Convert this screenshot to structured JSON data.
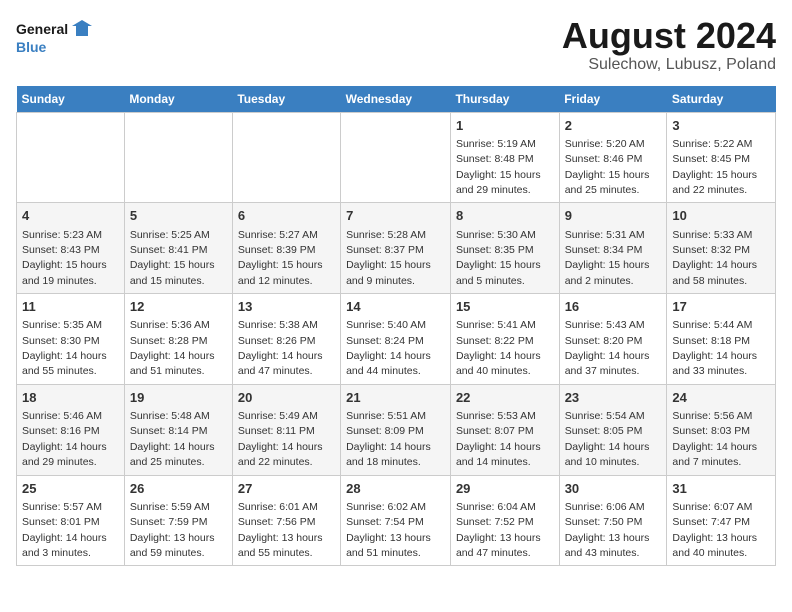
{
  "logo": {
    "line1": "General",
    "line2": "Blue"
  },
  "title": "August 2024",
  "subtitle": "Sulechow, Lubusz, Poland",
  "days_of_week": [
    "Sunday",
    "Monday",
    "Tuesday",
    "Wednesday",
    "Thursday",
    "Friday",
    "Saturday"
  ],
  "weeks": [
    [
      {
        "day": "",
        "info": ""
      },
      {
        "day": "",
        "info": ""
      },
      {
        "day": "",
        "info": ""
      },
      {
        "day": "",
        "info": ""
      },
      {
        "day": "1",
        "info": "Sunrise: 5:19 AM\nSunset: 8:48 PM\nDaylight: 15 hours\nand 29 minutes."
      },
      {
        "day": "2",
        "info": "Sunrise: 5:20 AM\nSunset: 8:46 PM\nDaylight: 15 hours\nand 25 minutes."
      },
      {
        "day": "3",
        "info": "Sunrise: 5:22 AM\nSunset: 8:45 PM\nDaylight: 15 hours\nand 22 minutes."
      }
    ],
    [
      {
        "day": "4",
        "info": "Sunrise: 5:23 AM\nSunset: 8:43 PM\nDaylight: 15 hours\nand 19 minutes."
      },
      {
        "day": "5",
        "info": "Sunrise: 5:25 AM\nSunset: 8:41 PM\nDaylight: 15 hours\nand 15 minutes."
      },
      {
        "day": "6",
        "info": "Sunrise: 5:27 AM\nSunset: 8:39 PM\nDaylight: 15 hours\nand 12 minutes."
      },
      {
        "day": "7",
        "info": "Sunrise: 5:28 AM\nSunset: 8:37 PM\nDaylight: 15 hours\nand 9 minutes."
      },
      {
        "day": "8",
        "info": "Sunrise: 5:30 AM\nSunset: 8:35 PM\nDaylight: 15 hours\nand 5 minutes."
      },
      {
        "day": "9",
        "info": "Sunrise: 5:31 AM\nSunset: 8:34 PM\nDaylight: 15 hours\nand 2 minutes."
      },
      {
        "day": "10",
        "info": "Sunrise: 5:33 AM\nSunset: 8:32 PM\nDaylight: 14 hours\nand 58 minutes."
      }
    ],
    [
      {
        "day": "11",
        "info": "Sunrise: 5:35 AM\nSunset: 8:30 PM\nDaylight: 14 hours\nand 55 minutes."
      },
      {
        "day": "12",
        "info": "Sunrise: 5:36 AM\nSunset: 8:28 PM\nDaylight: 14 hours\nand 51 minutes."
      },
      {
        "day": "13",
        "info": "Sunrise: 5:38 AM\nSunset: 8:26 PM\nDaylight: 14 hours\nand 47 minutes."
      },
      {
        "day": "14",
        "info": "Sunrise: 5:40 AM\nSunset: 8:24 PM\nDaylight: 14 hours\nand 44 minutes."
      },
      {
        "day": "15",
        "info": "Sunrise: 5:41 AM\nSunset: 8:22 PM\nDaylight: 14 hours\nand 40 minutes."
      },
      {
        "day": "16",
        "info": "Sunrise: 5:43 AM\nSunset: 8:20 PM\nDaylight: 14 hours\nand 37 minutes."
      },
      {
        "day": "17",
        "info": "Sunrise: 5:44 AM\nSunset: 8:18 PM\nDaylight: 14 hours\nand 33 minutes."
      }
    ],
    [
      {
        "day": "18",
        "info": "Sunrise: 5:46 AM\nSunset: 8:16 PM\nDaylight: 14 hours\nand 29 minutes."
      },
      {
        "day": "19",
        "info": "Sunrise: 5:48 AM\nSunset: 8:14 PM\nDaylight: 14 hours\nand 25 minutes."
      },
      {
        "day": "20",
        "info": "Sunrise: 5:49 AM\nSunset: 8:11 PM\nDaylight: 14 hours\nand 22 minutes."
      },
      {
        "day": "21",
        "info": "Sunrise: 5:51 AM\nSunset: 8:09 PM\nDaylight: 14 hours\nand 18 minutes."
      },
      {
        "day": "22",
        "info": "Sunrise: 5:53 AM\nSunset: 8:07 PM\nDaylight: 14 hours\nand 14 minutes."
      },
      {
        "day": "23",
        "info": "Sunrise: 5:54 AM\nSunset: 8:05 PM\nDaylight: 14 hours\nand 10 minutes."
      },
      {
        "day": "24",
        "info": "Sunrise: 5:56 AM\nSunset: 8:03 PM\nDaylight: 14 hours\nand 7 minutes."
      }
    ],
    [
      {
        "day": "25",
        "info": "Sunrise: 5:57 AM\nSunset: 8:01 PM\nDaylight: 14 hours\nand 3 minutes."
      },
      {
        "day": "26",
        "info": "Sunrise: 5:59 AM\nSunset: 7:59 PM\nDaylight: 13 hours\nand 59 minutes."
      },
      {
        "day": "27",
        "info": "Sunrise: 6:01 AM\nSunset: 7:56 PM\nDaylight: 13 hours\nand 55 minutes."
      },
      {
        "day": "28",
        "info": "Sunrise: 6:02 AM\nSunset: 7:54 PM\nDaylight: 13 hours\nand 51 minutes."
      },
      {
        "day": "29",
        "info": "Sunrise: 6:04 AM\nSunset: 7:52 PM\nDaylight: 13 hours\nand 47 minutes."
      },
      {
        "day": "30",
        "info": "Sunrise: 6:06 AM\nSunset: 7:50 PM\nDaylight: 13 hours\nand 43 minutes."
      },
      {
        "day": "31",
        "info": "Sunrise: 6:07 AM\nSunset: 7:47 PM\nDaylight: 13 hours\nand 40 minutes."
      }
    ]
  ]
}
